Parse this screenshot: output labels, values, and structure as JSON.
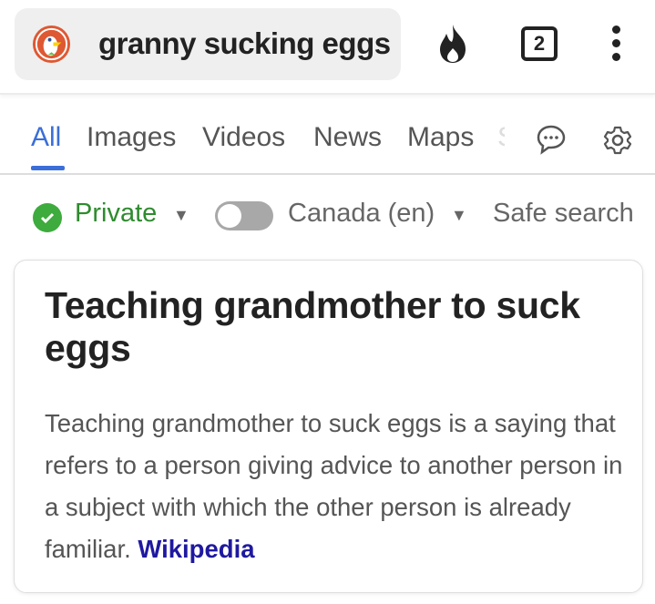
{
  "search": {
    "query": "granny sucking eggs",
    "tab_count": "2"
  },
  "nav": {
    "tabs": [
      "All",
      "Images",
      "Videos",
      "News",
      "Maps",
      "S"
    ],
    "active": "All"
  },
  "filters": {
    "private": "Private",
    "region": "Canada (en)",
    "safe_search": "Safe search",
    "region_toggle_on": false
  },
  "answer": {
    "title": "Teaching grandmother to suck eggs",
    "text": "Teaching grandmother to suck eggs is a saying that refers to a person giving advice to another person in a subject with which the other person is already familiar.",
    "source": "Wikipedia"
  },
  "colors": {
    "accent": "#3b6ed8",
    "private_green": "#2e8b2e",
    "link": "#1f19a0"
  }
}
